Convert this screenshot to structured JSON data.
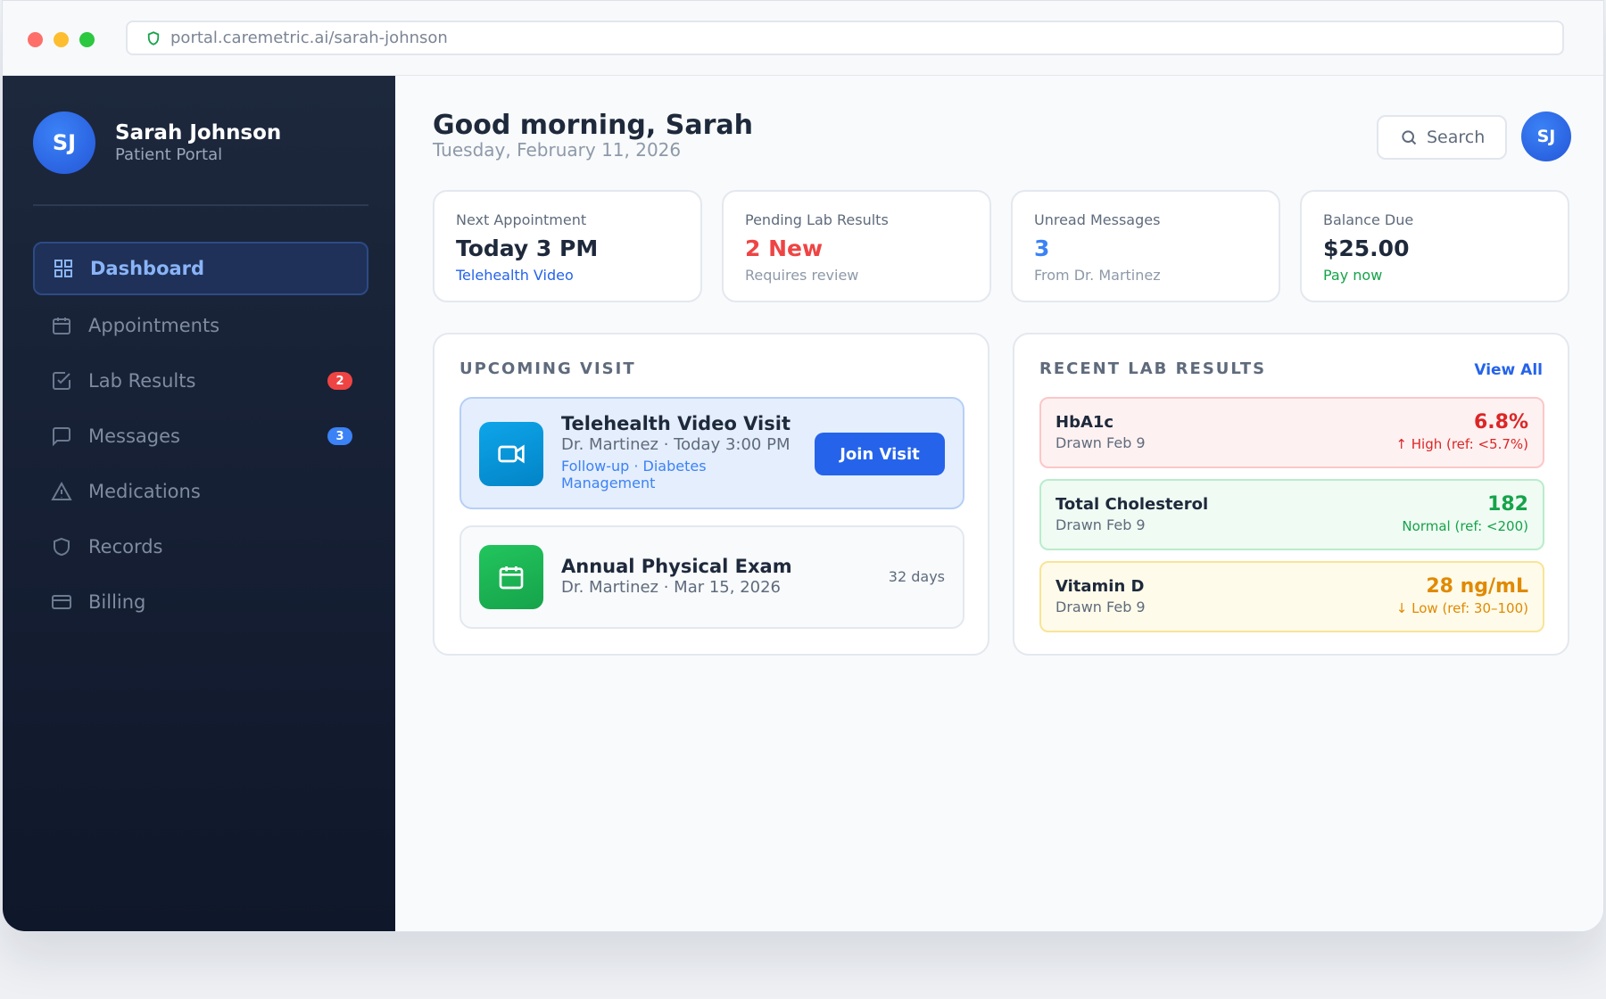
{
  "browser": {
    "url": "portal.caremetric.ai/sarah-johnson"
  },
  "sidebar": {
    "initials": "SJ",
    "name": "Sarah Johnson",
    "role": "Patient Portal",
    "items": [
      {
        "label": "Dashboard",
        "icon": "grid-icon",
        "active": true
      },
      {
        "label": "Appointments",
        "icon": "calendar-icon"
      },
      {
        "label": "Lab Results",
        "icon": "checkbox-icon",
        "badge": "2"
      },
      {
        "label": "Messages",
        "icon": "chat-icon",
        "badge": "3"
      },
      {
        "label": "Medications",
        "icon": "warning-icon"
      },
      {
        "label": "Records",
        "icon": "shield-icon"
      },
      {
        "label": "Billing",
        "icon": "credit-card-icon"
      }
    ]
  },
  "header": {
    "greeting": "Good morning, Sarah",
    "date": "Tuesday, February 11, 2026",
    "search_label": "Search",
    "avatar_initials": "SJ"
  },
  "stats": [
    {
      "label": "Next Appointment",
      "value": "Today 3 PM",
      "sub": "Telehealth Video",
      "value_color": "#1e293b",
      "sub_color": "#2563eb"
    },
    {
      "label": "Pending Lab Results",
      "value": "2 New",
      "sub": "Requires review",
      "value_color": "#ef4444",
      "sub_color": "#8e99a8"
    },
    {
      "label": "Unread Messages",
      "value": "3",
      "sub": "From Dr. Martinez",
      "value_color": "#3b82f6",
      "sub_color": "#8e99a8"
    },
    {
      "label": "Balance Due",
      "value": "$25.00",
      "sub": "Pay now",
      "value_color": "#1e293b",
      "sub_color": "#16a34a"
    }
  ],
  "upcoming": {
    "title": "UPCOMING VISIT",
    "visits": [
      {
        "title": "Telehealth Video Visit",
        "doctor": "Dr. Martinez · Today 3:00 PM",
        "tag": "Follow-up · Diabetes Management",
        "action": "Join Visit",
        "icon": "video-icon"
      },
      {
        "title": "Annual Physical Exam",
        "doctor": "Dr. Martinez · Mar 15, 2026",
        "countdown": "32 days",
        "icon": "calendar-icon"
      }
    ]
  },
  "labs": {
    "title": "RECENT LAB RESULTS",
    "view_all": "View All",
    "results": [
      {
        "name": "HbA1c",
        "drawn": "Drawn Feb 9",
        "value": "6.8%",
        "ref": "↑ High (ref: <5.7%)",
        "color": "#dc2626"
      },
      {
        "name": "Total Cholesterol",
        "drawn": "Drawn Feb 9",
        "value": "182",
        "ref": "Normal (ref: <200)",
        "color": "#16a34a"
      },
      {
        "name": "Vitamin D",
        "drawn": "Drawn Feb 9",
        "value": "28 ng/mL",
        "ref": "↓ Low (ref: 30–100)",
        "color": "#e08a00"
      }
    ]
  }
}
